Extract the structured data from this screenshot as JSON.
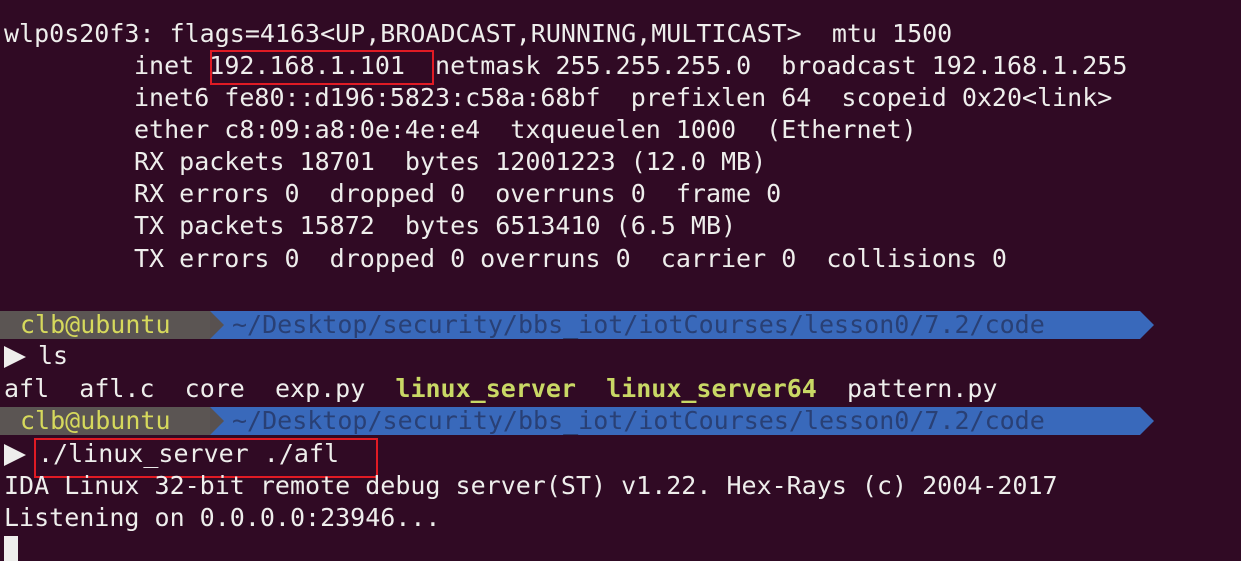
{
  "ifconfig": {
    "header": "wlp0s20f3: flags=4163<UP,BROADCAST,RUNNING,MULTICAST>  mtu 1500",
    "inet_label": "inet ",
    "inet_addr": "192.168.1.101",
    "inet_rest": "  netmask 255.255.255.0  broadcast 192.168.1.255",
    "inet6": "inet6 fe80::d196:5823:c58a:68bf  prefixlen 64  scopeid 0x20<link>",
    "ether": "ether c8:09:a8:0e:4e:e4  txqueuelen 1000  (Ethernet)",
    "rx_packets": "RX packets 18701  bytes 12001223 (12.0 MB)",
    "rx_errors": "RX errors 0  dropped 0  overruns 0  frame 0",
    "tx_packets": "TX packets 15872  bytes 6513410 (6.5 MB)",
    "tx_errors": "TX errors 0  dropped 0 overruns 0  carrier 0  collisions 0"
  },
  "prompt": {
    "user": "clb@ubuntu",
    "path": "~/Desktop/security/bbs_iot/iotCourses/lesson0/7.2/code"
  },
  "commands": {
    "ls": "ls",
    "run": "./linux_server ./afl"
  },
  "ls_output": [
    "afl",
    "afl.c",
    "core",
    "exp.py",
    "linux_server",
    "linux_server64",
    "pattern.py"
  ],
  "server_output": {
    "banner": "IDA Linux 32-bit remote debug server(ST) v1.22. Hex-Rays (c) 2004-2017",
    "listening": "Listening on 0.0.0.0:23946..."
  },
  "colors": {
    "background": "#300a24",
    "text": "#eeeeec",
    "prompt_user_bg": "#5b5553",
    "prompt_user_fg": "#d6d95c",
    "prompt_path_bg": "#3a6fc4",
    "executable": "#c9d865",
    "highlight_box": "#e01b24"
  }
}
